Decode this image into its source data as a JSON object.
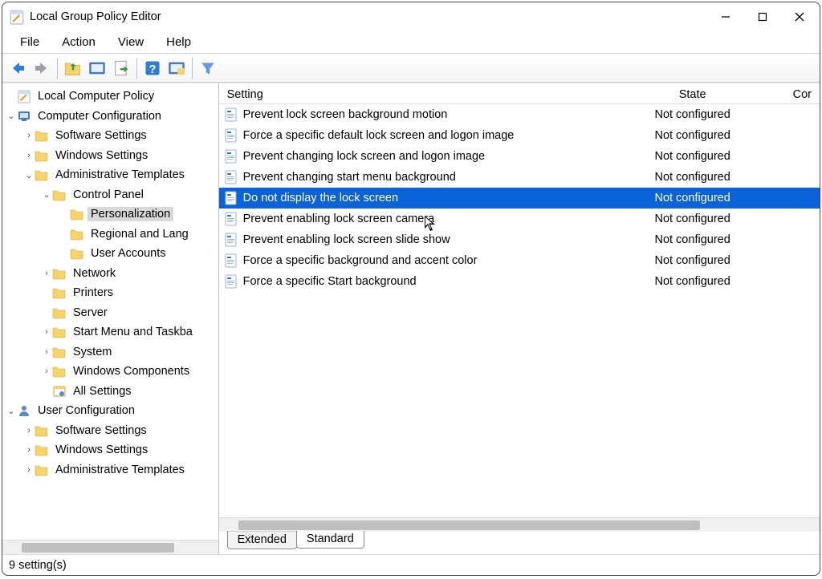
{
  "window": {
    "title": "Local Group Policy Editor"
  },
  "menu": {
    "file": "File",
    "action": "Action",
    "view": "View",
    "help": "Help"
  },
  "tree": {
    "root": "Local Computer Policy",
    "cc": "Computer Configuration",
    "cc_sw": "Software Settings",
    "cc_ws": "Windows Settings",
    "cc_at": "Administrative Templates",
    "cp": "Control Panel",
    "cp_pers": "Personalization",
    "cp_reg": "Regional and Language Options",
    "cp_ua": "User Accounts",
    "network": "Network",
    "printers": "Printers",
    "server": "Server",
    "startmenu": "Start Menu and Taskbar",
    "system": "System",
    "wincomp": "Windows Components",
    "allset": "All Settings",
    "uc": "User Configuration",
    "uc_sw": "Software Settings",
    "uc_ws": "Windows Settings",
    "uc_at": "Administrative Templates"
  },
  "list": {
    "col_setting": "Setting",
    "col_state": "State",
    "col_cor": "Cor",
    "rows": [
      {
        "setting": "Prevent lock screen background motion",
        "state": "Not configured",
        "selected": false
      },
      {
        "setting": "Force a specific default lock screen and logon image",
        "state": "Not configured",
        "selected": false
      },
      {
        "setting": "Prevent changing lock screen and logon image",
        "state": "Not configured",
        "selected": false
      },
      {
        "setting": "Prevent changing start menu background",
        "state": "Not configured",
        "selected": false
      },
      {
        "setting": "Do not display the lock screen",
        "state": "Not configured",
        "selected": true
      },
      {
        "setting": "Prevent enabling lock screen camera",
        "state": "Not configured",
        "selected": false
      },
      {
        "setting": "Prevent enabling lock screen slide show",
        "state": "Not configured",
        "selected": false
      },
      {
        "setting": "Force a specific background and accent color",
        "state": "Not configured",
        "selected": false
      },
      {
        "setting": "Force a specific Start background",
        "state": "Not configured",
        "selected": false
      }
    ]
  },
  "tabs": {
    "extended": "Extended",
    "standard": "Standard"
  },
  "status": "9 setting(s)"
}
